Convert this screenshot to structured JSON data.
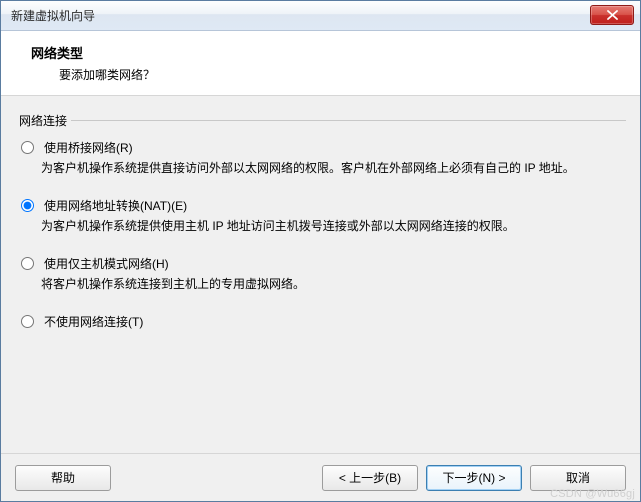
{
  "window": {
    "title": "新建虚拟机向导"
  },
  "header": {
    "title": "网络类型",
    "subtitle": "要添加哪类网络？"
  },
  "fieldset": {
    "legend": "网络连接"
  },
  "options": {
    "bridged": {
      "label": "使用桥接网络(R)",
      "desc": "为客户机操作系统提供直接访问外部以太网网络的权限。客户机在外部网络上必须有自己的 IP 地址。",
      "checked": false
    },
    "nat": {
      "label": "使用网络地址转换(NAT)(E)",
      "desc": "为客户机操作系统提供使用主机 IP 地址访问主机拨号连接或外部以太网网络连接的权限。",
      "checked": true
    },
    "hostonly": {
      "label": "使用仅主机模式网络(H)",
      "desc": "将客户机操作系统连接到主机上的专用虚拟网络。",
      "checked": false
    },
    "none": {
      "label": "不使用网络连接(T)",
      "checked": false
    }
  },
  "footer": {
    "help": "帮助",
    "back": "< 上一步(B)",
    "next": "下一步(N) >",
    "cancel": "取消"
  },
  "watermark": "CSDN @Wu66gj"
}
